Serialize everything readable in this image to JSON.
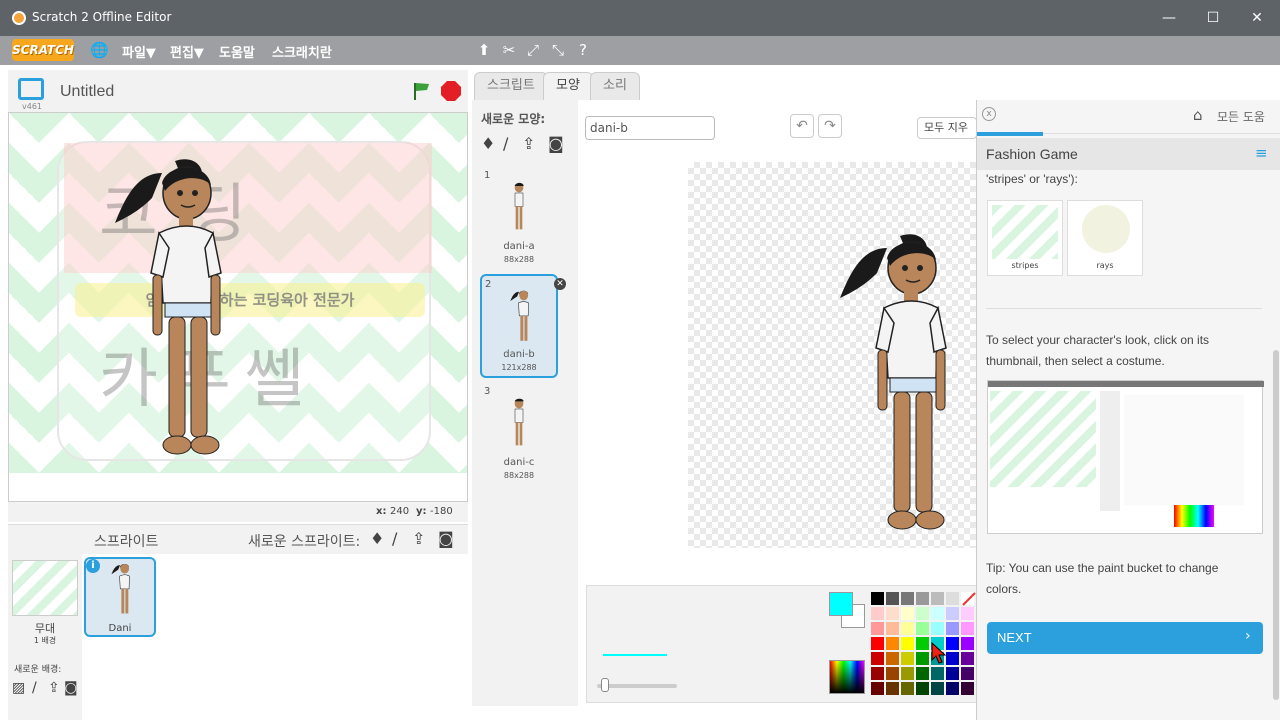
{
  "window": {
    "title": "Scratch 2 Offline Editor"
  },
  "menubar": {
    "brand": "SCRATCH",
    "items": [
      "파일▼",
      "편집▼",
      "도움말",
      "스크래치란"
    ]
  },
  "stage": {
    "project_title": "Untitled",
    "version": "v461",
    "coords": {
      "x_label": "x:",
      "x": "240",
      "y_label": "y:",
      "y": "-180"
    },
    "watermark": {
      "top": "코딩",
      "banner": "엄마와 함께하는 코딩육아 전문가",
      "bottom": "카푸쎌"
    }
  },
  "sprites": {
    "header": "스프라이트",
    "new_sprite_label": "새로운 스프라이트:",
    "stage_label": "무대",
    "stage_count": "1 배경",
    "new_backdrop_label": "새로운 배경:",
    "items": [
      {
        "name": "Dani"
      }
    ]
  },
  "tabs": [
    "스크립트",
    "모양",
    "소리"
  ],
  "costumes": {
    "new_label": "새로운 모양:",
    "items": [
      {
        "num": "1",
        "name": "dani-a",
        "size": "88x288"
      },
      {
        "num": "2",
        "name": "dani-b",
        "size": "121x288"
      },
      {
        "num": "3",
        "name": "dani-c",
        "size": "88x288"
      }
    ]
  },
  "editor": {
    "costume_name": "dani-b",
    "clear_label": "모두 지우"
  },
  "help": {
    "all_help": "모든 도움",
    "title": "Fashion Game",
    "text_top": "'stripes' or 'rays'):",
    "thumb1": "stripes",
    "thumb2": "rays",
    "text_mid": "To select your character's look, click on its thumbnail, then select a costume.",
    "tip": "Tip: You can use the paint bucket to change colors.",
    "next": "NEXT"
  },
  "colors": {
    "accent": "#2ba0dd",
    "menubar": "#9d9fa2",
    "titlebar": "#5e6367",
    "fill_color": "#00ffff"
  }
}
